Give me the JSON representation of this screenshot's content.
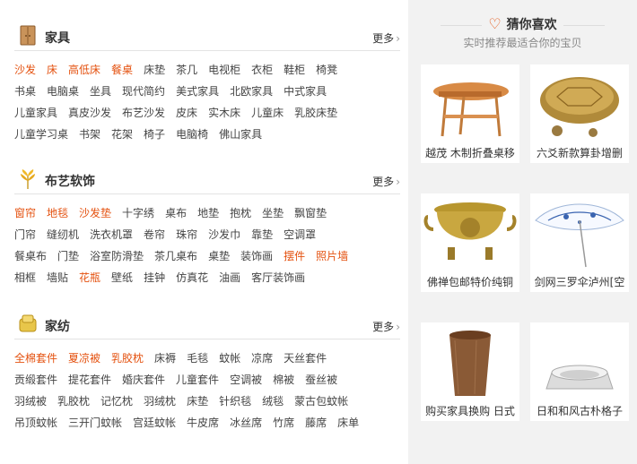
{
  "sections": [
    {
      "title": "家具",
      "more": "更多",
      "rows": [
        [
          {
            "t": "沙发",
            "hot": true
          },
          {
            "t": "床",
            "hot": true
          },
          {
            "t": "高低床",
            "hot": true
          },
          {
            "t": "餐桌",
            "hot": true
          },
          {
            "t": "床垫"
          },
          {
            "t": "茶几"
          },
          {
            "t": "电视柜"
          },
          {
            "t": "衣柜"
          },
          {
            "t": "鞋柜"
          },
          {
            "t": "椅凳"
          }
        ],
        [
          {
            "t": "书桌"
          },
          {
            "t": "电脑桌"
          },
          {
            "t": "坐具"
          },
          {
            "t": "现代简约"
          },
          {
            "t": "美式家具"
          },
          {
            "t": "北欧家具"
          },
          {
            "t": "中式家具"
          }
        ],
        [
          {
            "t": "儿童家具"
          },
          {
            "t": "真皮沙发"
          },
          {
            "t": "布艺沙发"
          },
          {
            "t": "皮床"
          },
          {
            "t": "实木床"
          },
          {
            "t": "儿童床"
          },
          {
            "t": "乳胶床垫"
          }
        ],
        [
          {
            "t": "儿童学习桌"
          },
          {
            "t": "书架"
          },
          {
            "t": "花架"
          },
          {
            "t": "椅子"
          },
          {
            "t": "电脑椅"
          },
          {
            "t": "佛山家具"
          }
        ]
      ]
    },
    {
      "title": "布艺软饰",
      "more": "更多",
      "rows": [
        [
          {
            "t": "窗帘",
            "hot": true
          },
          {
            "t": "地毯",
            "hot": true
          },
          {
            "t": "沙发垫",
            "hot": true
          },
          {
            "t": "十字绣"
          },
          {
            "t": "桌布"
          },
          {
            "t": "地垫"
          },
          {
            "t": "抱枕"
          },
          {
            "t": "坐垫"
          },
          {
            "t": "飘窗垫"
          }
        ],
        [
          {
            "t": "门帘"
          },
          {
            "t": "缝纫机"
          },
          {
            "t": "洗衣机罩"
          },
          {
            "t": "卷帘"
          },
          {
            "t": "珠帘"
          },
          {
            "t": "沙发巾"
          },
          {
            "t": "靠垫"
          },
          {
            "t": "空调罩"
          }
        ],
        [
          {
            "t": "餐桌布"
          },
          {
            "t": "门垫"
          },
          {
            "t": "浴室防滑垫"
          },
          {
            "t": "茶几桌布"
          },
          {
            "t": "桌垫"
          },
          {
            "t": "装饰画"
          },
          {
            "t": "摆件",
            "hot": true
          },
          {
            "t": "照片墙",
            "hot": true
          }
        ],
        [
          {
            "t": "相框"
          },
          {
            "t": "墙贴"
          },
          {
            "t": "花瓶",
            "hot": true
          },
          {
            "t": "壁纸"
          },
          {
            "t": "挂钟"
          },
          {
            "t": "仿真花"
          },
          {
            "t": "油画"
          },
          {
            "t": "客厅装饰画"
          }
        ]
      ]
    },
    {
      "title": "家纺",
      "more": "更多",
      "rows": [
        [
          {
            "t": "全棉套件",
            "hot": true
          },
          {
            "t": "夏凉被",
            "hot": true
          },
          {
            "t": "乳胶枕",
            "hot": true
          },
          {
            "t": "床褥"
          },
          {
            "t": "毛毯"
          },
          {
            "t": "蚊帐"
          },
          {
            "t": "凉席"
          },
          {
            "t": "天丝套件"
          }
        ],
        [
          {
            "t": "贡缎套件"
          },
          {
            "t": "提花套件"
          },
          {
            "t": "婚庆套件"
          },
          {
            "t": "儿童套件"
          },
          {
            "t": "空调被"
          },
          {
            "t": "棉被"
          },
          {
            "t": "蚕丝被"
          }
        ],
        [
          {
            "t": "羽绒被"
          },
          {
            "t": "乳胶枕"
          },
          {
            "t": "记忆枕"
          },
          {
            "t": "羽绒枕"
          },
          {
            "t": "床垫"
          },
          {
            "t": "针织毯"
          },
          {
            "t": "绒毯"
          },
          {
            "t": "蒙古包蚊帐"
          }
        ],
        [
          {
            "t": "吊顶蚊帐"
          },
          {
            "t": "三开门蚊帐"
          },
          {
            "t": "宫廷蚊帐"
          },
          {
            "t": "牛皮席"
          },
          {
            "t": "冰丝席"
          },
          {
            "t": "竹席"
          },
          {
            "t": "藤席"
          },
          {
            "t": "床单"
          }
        ]
      ]
    }
  ],
  "recommend": {
    "title": "猜你喜欢",
    "subtitle": "实时推荐最适合你的宝贝",
    "items": [
      {
        "caption": "越茂 木制折叠桌移",
        "icon": "folding-table"
      },
      {
        "caption": "六爻新款算卦增删",
        "icon": "turtle-shell"
      },
      {
        "caption": "佛禅包邮特价纯铜",
        "icon": "censer"
      },
      {
        "caption": "剑网三罗伞泸州[空",
        "icon": "umbrella"
      },
      {
        "caption": "购买家具换购 日式",
        "icon": "wood-cup"
      },
      {
        "caption": "日和和风古朴格子",
        "icon": "ashtray"
      }
    ]
  },
  "colors": {
    "hot": "#e4510f",
    "accent": "#e4510f",
    "panel": "#f2f2f2"
  }
}
